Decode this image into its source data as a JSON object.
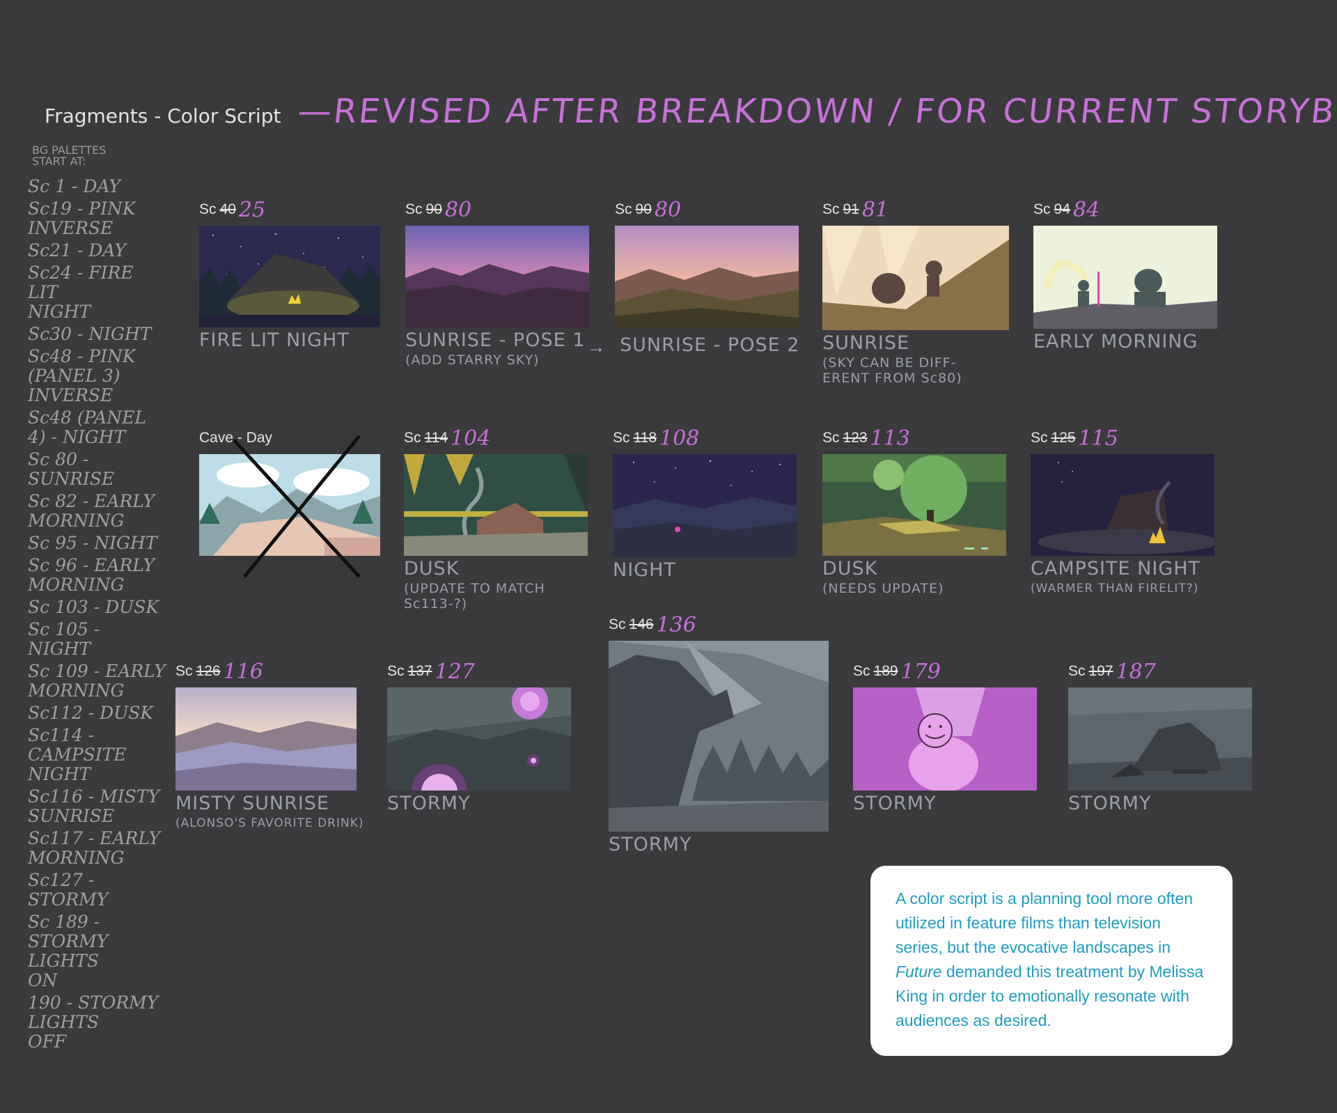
{
  "header": {
    "title": "Fragments - Color Script",
    "handwritten": "—REVISED AFTER BREAKDOWN / FOR CURRENT STORYBOARD"
  },
  "sidebar": {
    "heading": "BG PALETTES START AT:",
    "items": [
      "Sc 1 - DAY",
      "Sc19 - PINK\nINVERSE",
      "Sc21 - DAY",
      "Sc24 - FIRE LIT\nNIGHT",
      "Sc30 - NIGHT",
      "Sc48 - PINK\n(PANEL 3) INVERSE",
      "Sc48 (PANEL 4) - NIGHT",
      "Sc 80 - SUNRISE",
      "Sc 82 - EARLY\nMORNING",
      "Sc 95 - NIGHT",
      "Sc 96 - EARLY\nMORNING",
      "Sc 103 - DUSK",
      "Sc 105 - NIGHT",
      "Sc 109 - EARLY\nMORNING",
      "Sc112 - DUSK",
      "Sc114 - CAMPSITE\nNIGHT",
      "Sc116 - MISTY\nSUNRISE",
      "Sc117 - EARLY\nMORNING",
      "Sc127 - STORMY",
      "Sc 189 - STORMY\nLIGHTS\nON",
      "190 - STORMY\nLIGHTS\nOFF"
    ]
  },
  "scenes": {
    "s1": {
      "prefix": "Sc",
      "old": "40",
      "new": "25",
      "caption": "FIRE LIT NIGHT",
      "sub": ""
    },
    "s2": {
      "prefix": "Sc",
      "old": "90",
      "new": "80",
      "caption": "SUNRISE - POSE 1",
      "sub": "(ADD STARRY SKY)"
    },
    "s3": {
      "prefix": "Sc",
      "old": "90",
      "new": "80",
      "caption": "SUNRISE - POSE 2",
      "sub": ""
    },
    "s4": {
      "prefix": "Sc",
      "old": "91",
      "new": "81",
      "caption": "SUNRISE",
      "sub": "(SKY CAN BE DIFF-ERENT FROM Sc80)"
    },
    "s5": {
      "prefix": "Sc",
      "old": "94",
      "new": "84",
      "caption": "EARLY MORNING",
      "sub": ""
    },
    "s6": {
      "title": "Cave - Day"
    },
    "s7": {
      "prefix": "Sc",
      "old": "114",
      "new": "104",
      "caption": "DUSK",
      "sub": "(UPDATE TO MATCH Sc113-?)"
    },
    "s8": {
      "prefix": "Sc",
      "old": "118",
      "new": "108",
      "caption": "NIGHT",
      "sub": ""
    },
    "s9": {
      "prefix": "Sc",
      "old": "123",
      "new": "113",
      "caption": "DUSK",
      "sub": "(NEEDS UPDATE)"
    },
    "s10": {
      "prefix": "Sc",
      "old": "125",
      "new": "115",
      "caption": "CAMPSITE NIGHT",
      "sub": "(WARMER THAN FIRELIT?)"
    },
    "s11": {
      "prefix": "Sc",
      "old": "146",
      "new": "136",
      "caption": "STORMY",
      "sub": ""
    },
    "s12": {
      "prefix": "Sc",
      "old": "126",
      "new": "116",
      "caption": "MISTY SUNRISE",
      "sub": "(ALONSO'S FAVORITE DRINK)"
    },
    "s13": {
      "prefix": "Sc",
      "old": "137",
      "new": "127",
      "caption": "STORMY",
      "sub": ""
    },
    "s14": {
      "prefix": "Sc",
      "old": "189",
      "new": "179",
      "caption": "STORMY",
      "sub": ""
    },
    "s15": {
      "prefix": "Sc",
      "old": "197",
      "new": "187",
      "caption": "STORMY",
      "sub": ""
    }
  },
  "arrow": "→",
  "info": {
    "line_before": "A color script is a planning tool more often utilized in feature films than television series, but the evocative landscapes in ",
    "italic": "Future",
    "line_after": " demanded this treatment by Melissa King in order to emotionally resonate with audiences as desired."
  },
  "colors": {
    "accent": "#c970db",
    "handwriting": "#9aa0a6",
    "info_text": "#1f9cc4",
    "background": "#3a3a3c"
  }
}
